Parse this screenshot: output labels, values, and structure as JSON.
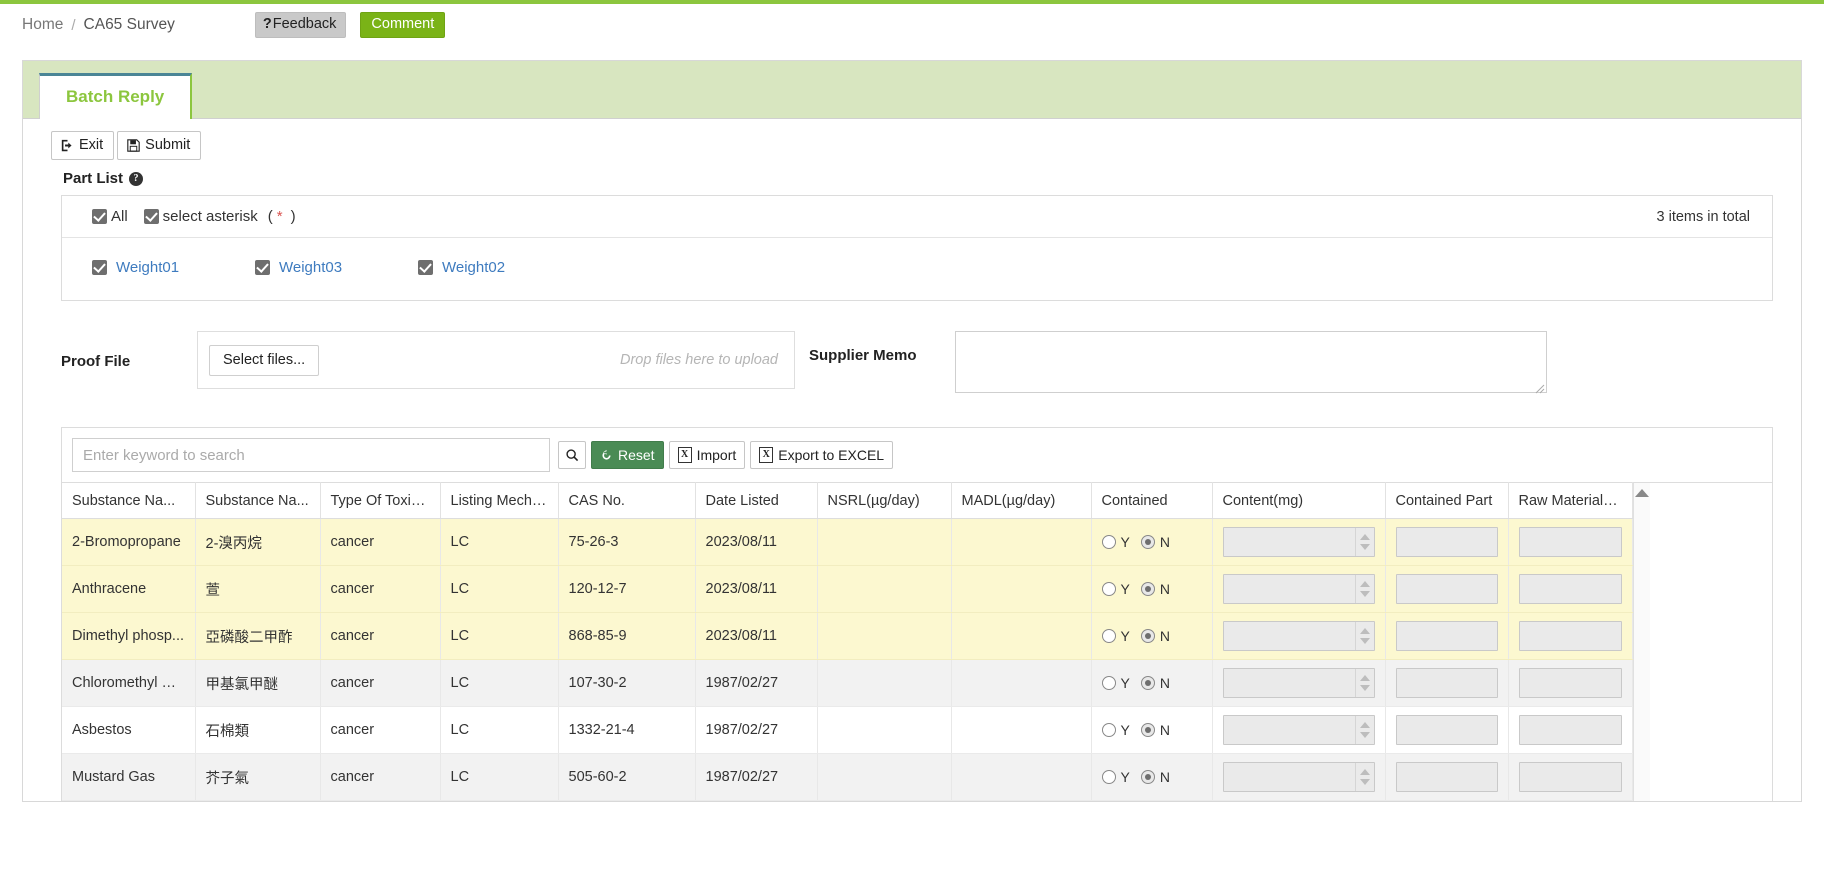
{
  "theme": {
    "accent_green": "#8cc63e",
    "tab_border": "#4a8596",
    "highlight_row": "#fcf8d0",
    "reset_green": "#4a8b55",
    "link_blue": "#3e7bbf"
  },
  "breadcrumb": {
    "home": "Home",
    "separator": "/",
    "current": "CA65 Survey"
  },
  "header_buttons": {
    "feedback_mark": "?",
    "feedback": "Feedback",
    "comment": "Comment"
  },
  "tab": {
    "label": "Batch Reply"
  },
  "actions": {
    "exit": "Exit",
    "submit": "Submit"
  },
  "part_list": {
    "title": "Part List",
    "all_label": "All",
    "asterisk_label": "select asterisk",
    "asterisk_open": "(",
    "asterisk_mark": "*",
    "asterisk_close": ")",
    "total": "3 items in total",
    "items": [
      {
        "label": "Weight01",
        "checked": true
      },
      {
        "label": "Weight03",
        "checked": true
      },
      {
        "label": "Weight02",
        "checked": true
      }
    ]
  },
  "proof_file": {
    "label": "Proof File",
    "select_button": "Select files...",
    "drop_hint": "Drop files here to upload"
  },
  "supplier_memo": {
    "label": "Supplier Memo",
    "value": "",
    "placeholder": ""
  },
  "toolbar": {
    "search_placeholder": "Enter keyword to search",
    "search_value": "",
    "reset": "Reset",
    "import": "Import",
    "export": "Export to EXCEL",
    "xls_glyph": "X"
  },
  "table": {
    "columns": [
      "Substance Na...",
      "Substance Na...",
      "Type Of Toxicity",
      "Listing Mechani...",
      "CAS No.",
      "Date Listed",
      "NSRL(µg/day)",
      "MADL(µg/day)",
      "Contained",
      "Content(mg)",
      "Contained Part",
      "Raw Material N..."
    ],
    "radio_yes": "Y",
    "radio_no": "N",
    "rows": [
      {
        "style": "hl",
        "name_en": "2-Bromopropane",
        "name_zh": "2-溴丙烷",
        "toxicity": "cancer",
        "mechanism": "LC",
        "cas": "75-26-3",
        "date": "2023/08/11",
        "nsrl": "",
        "madl": "",
        "contained": "N",
        "content": "",
        "contained_part": "",
        "raw_material": ""
      },
      {
        "style": "hl",
        "name_en": "Anthracene",
        "name_zh": "萱",
        "toxicity": "cancer",
        "mechanism": "LC",
        "cas": "120-12-7",
        "date": "2023/08/11",
        "nsrl": "",
        "madl": "",
        "contained": "N",
        "content": "",
        "contained_part": "",
        "raw_material": ""
      },
      {
        "style": "hl",
        "name_en": "Dimethyl phosp...",
        "name_zh": "亞磷酸二甲酢",
        "toxicity": "cancer",
        "mechanism": "LC",
        "cas": "868-85-9",
        "date": "2023/08/11",
        "nsrl": "",
        "madl": "",
        "contained": "N",
        "content": "",
        "contained_part": "",
        "raw_material": ""
      },
      {
        "style": "alt",
        "name_en": "Chloromethyl m...",
        "name_zh": "甲基氯甲醚",
        "toxicity": "cancer",
        "mechanism": "LC",
        "cas": "107-30-2",
        "date": "1987/02/27",
        "nsrl": "",
        "madl": "",
        "contained": "N",
        "content": "",
        "contained_part": "",
        "raw_material": ""
      },
      {
        "style": "plain",
        "name_en": "Asbestos",
        "name_zh": "石棉類",
        "toxicity": "cancer",
        "mechanism": "LC",
        "cas": "1332-21-4",
        "date": "1987/02/27",
        "nsrl": "",
        "madl": "",
        "contained": "N",
        "content": "",
        "contained_part": "",
        "raw_material": ""
      },
      {
        "style": "alt",
        "name_en": "Mustard Gas",
        "name_zh": "芥子氣",
        "toxicity": "cancer",
        "mechanism": "LC",
        "cas": "505-60-2",
        "date": "1987/02/27",
        "nsrl": "",
        "madl": "",
        "contained": "N",
        "content": "",
        "contained_part": "",
        "raw_material": ""
      }
    ]
  }
}
